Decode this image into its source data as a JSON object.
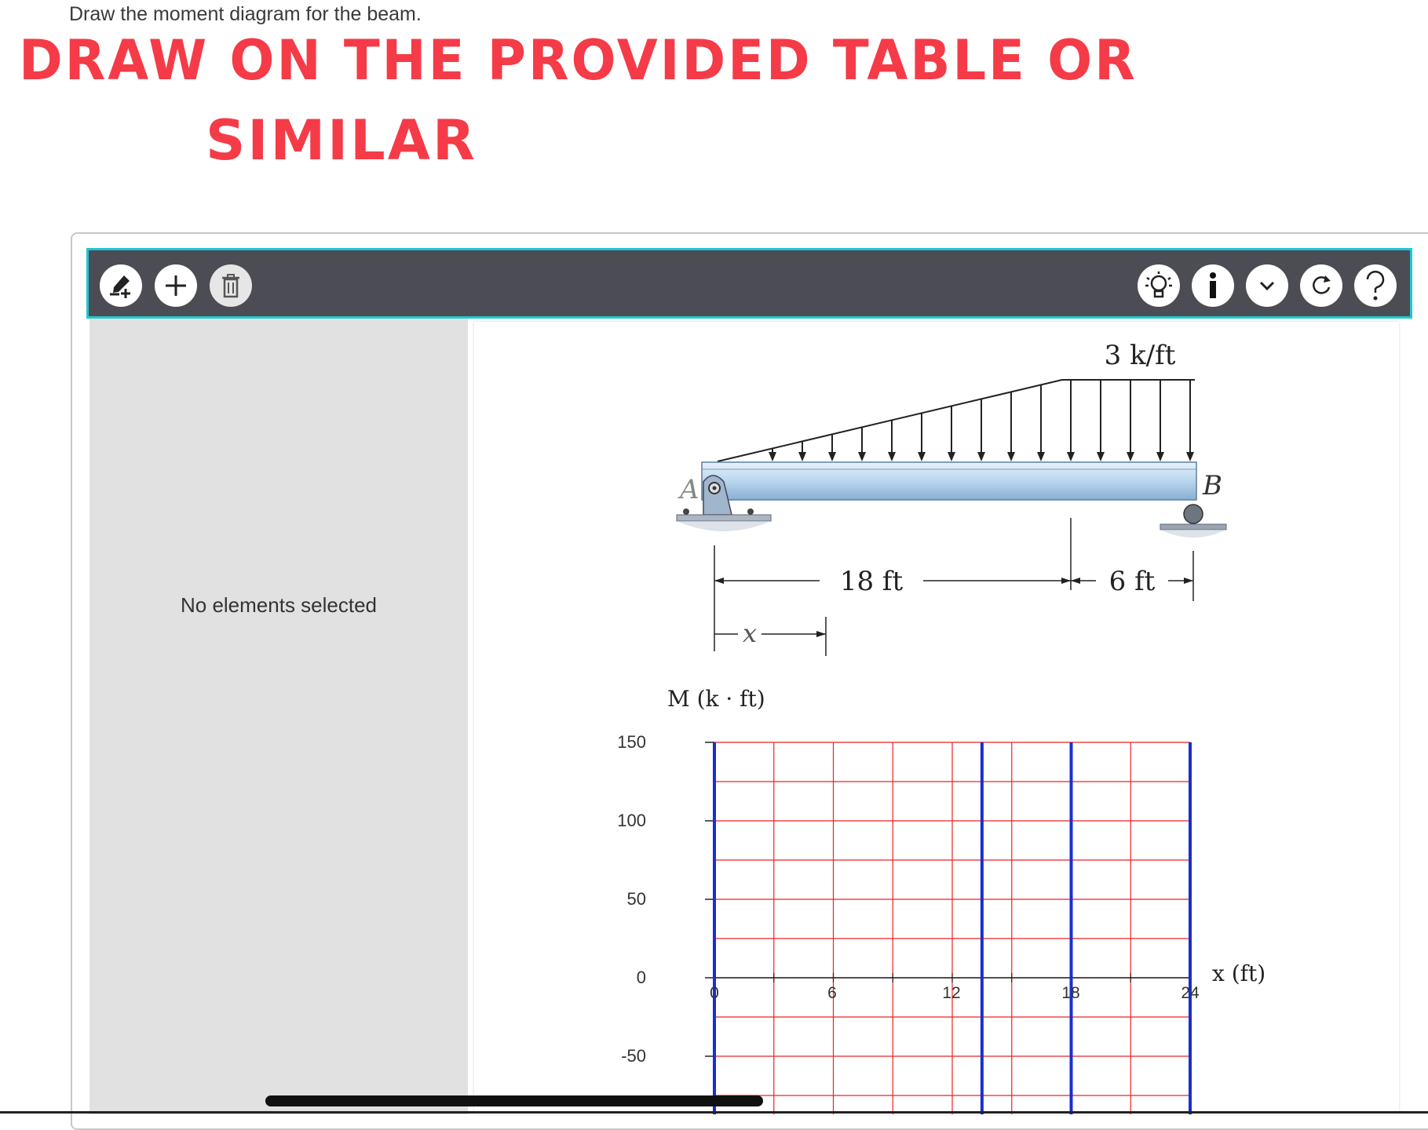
{
  "question": {
    "text": "Draw the moment diagram for the beam."
  },
  "handwritten_note": {
    "line1": "DRAW ON THE PROVIDED TABLE  OR",
    "line2": "SIMILAR",
    "color": "#f53b47"
  },
  "toolbar": {
    "left_tools": [
      {
        "icon": "pencil-add-icon",
        "label": ""
      },
      {
        "icon": "plus-icon",
        "label": ""
      },
      {
        "icon": "trash-icon",
        "label": ""
      }
    ],
    "right_tools": [
      {
        "icon": "lightbulb-hint-icon"
      },
      {
        "icon": "info-icon"
      },
      {
        "icon": "chevron-down-icon"
      },
      {
        "icon": "redo-icon"
      },
      {
        "icon": "help-question-icon"
      }
    ],
    "accent_color": "#1ec8d2",
    "background_color": "#4c4c55"
  },
  "side_panel": {
    "message": "No elements selected"
  },
  "beam_figure": {
    "load_label": "3 k/ft",
    "support_a_label": "A",
    "support_b_label": "B",
    "span_ab_label": "18 ft",
    "overhang_label": "6 ft",
    "x_label": "x"
  },
  "moment_graph": {
    "y_axis_label": "M (k · ft)",
    "x_axis_label": "x (ft)",
    "y_ticks": [
      "150",
      "100",
      "50",
      "0",
      "-50"
    ],
    "x_ticks": [
      "0",
      "6",
      "12",
      "18",
      "24"
    ],
    "grid_color": "#ee2222",
    "guide_line_color": "#1a2fcc",
    "blue_guides_x": [
      0,
      13.5,
      18,
      24
    ]
  }
}
